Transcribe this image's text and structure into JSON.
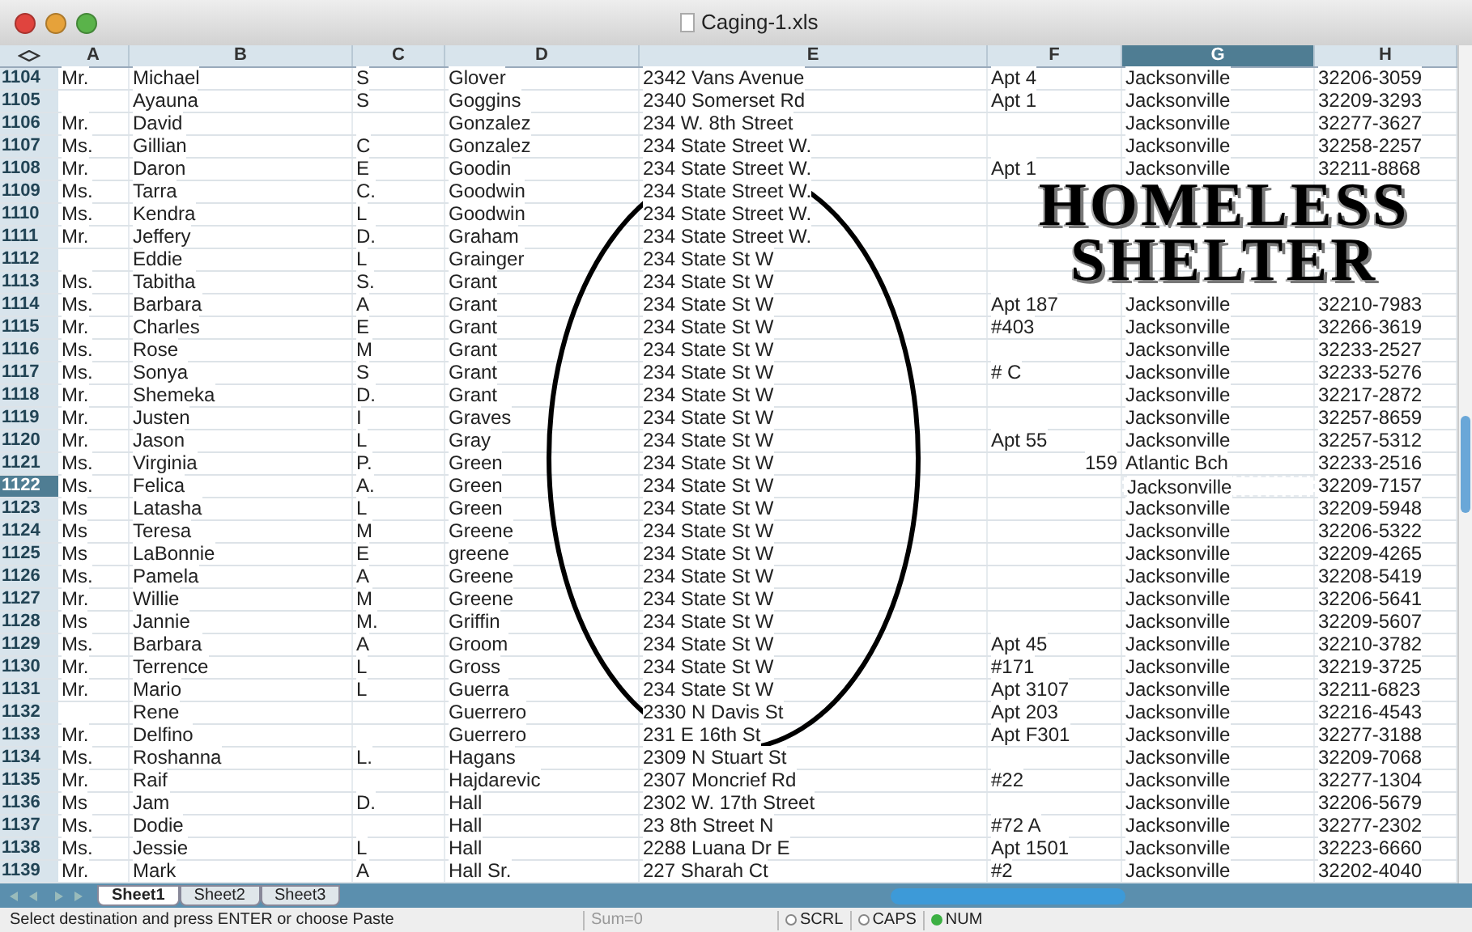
{
  "window": {
    "title": "Caging-1.xls"
  },
  "columns": [
    {
      "label": "A",
      "selected": false
    },
    {
      "label": "B",
      "selected": false
    },
    {
      "label": "C",
      "selected": false
    },
    {
      "label": "D",
      "selected": false
    },
    {
      "label": "E",
      "selected": false
    },
    {
      "label": "F",
      "selected": false
    },
    {
      "label": "G",
      "selected": true
    },
    {
      "label": "H",
      "selected": false
    }
  ],
  "rows": [
    {
      "number": "1104",
      "selected": false,
      "cells": [
        "Mr.",
        "Michael",
        "S",
        "Glover",
        "2342 Vans Avenue",
        "Apt 4",
        "Jacksonville",
        "32206-3059"
      ]
    },
    {
      "number": "1105",
      "selected": false,
      "cells": [
        null,
        "Ayauna",
        "S",
        "Goggins",
        "2340 Somerset Rd",
        "Apt 1",
        "Jacksonville",
        "32209-3293"
      ]
    },
    {
      "number": "1106",
      "selected": false,
      "cells": [
        "Mr.",
        "David",
        null,
        "Gonzalez",
        "234 W. 8th Street",
        null,
        "Jacksonville",
        "32277-3627"
      ]
    },
    {
      "number": "1107",
      "selected": false,
      "cells": [
        "Ms.",
        "Gillian",
        "C",
        "Gonzalez",
        "234 State Street W.",
        null,
        "Jacksonville",
        "32258-2257"
      ]
    },
    {
      "number": "1108",
      "selected": false,
      "cells": [
        "Mr.",
        "Daron",
        "E",
        "Goodin",
        "234 State Street W.",
        "Apt 1",
        "Jacksonville",
        "32211-8868"
      ]
    },
    {
      "number": "1109",
      "selected": false,
      "cells": [
        "Ms.",
        "Tarra",
        "C.",
        "Goodwin",
        "234 State Street W.",
        null,
        null,
        null
      ]
    },
    {
      "number": "1110",
      "selected": false,
      "cells": [
        "Ms.",
        "Kendra",
        "L",
        "Goodwin",
        "234 State Street W.",
        null,
        null,
        null
      ]
    },
    {
      "number": "1111",
      "selected": false,
      "cells": [
        "Mr.",
        "Jeffery",
        "D.",
        "Graham",
        "234 State Street W.",
        null,
        null,
        null
      ]
    },
    {
      "number": "1112",
      "selected": false,
      "cells": [
        null,
        "Eddie",
        "L",
        "Grainger",
        "234 State St W",
        null,
        null,
        null
      ]
    },
    {
      "number": "1113",
      "selected": false,
      "cells": [
        "Ms.",
        "Tabitha",
        "S.",
        "Grant",
        "234 State St W",
        null,
        null,
        null
      ]
    },
    {
      "number": "1114",
      "selected": false,
      "cells": [
        "Ms.",
        "Barbara",
        "A",
        "Grant",
        "234 State St W",
        "Apt 187",
        "Jacksonville",
        "32210-7983"
      ]
    },
    {
      "number": "1115",
      "selected": false,
      "cells": [
        "Mr.",
        "Charles",
        "E",
        "Grant",
        "234 State St W",
        "#403",
        "Jacksonville",
        "32266-3619"
      ]
    },
    {
      "number": "1116",
      "selected": false,
      "cells": [
        "Ms.",
        "Rose",
        "M",
        "Grant",
        "234 State St W",
        null,
        "Jacksonville",
        "32233-2527"
      ]
    },
    {
      "number": "1117",
      "selected": false,
      "cells": [
        "Ms.",
        "Sonya",
        "S",
        "Grant",
        "234 State St W",
        "# C",
        "Jacksonville",
        "32233-5276"
      ]
    },
    {
      "number": "1118",
      "selected": false,
      "cells": [
        "Mr.",
        "Shemeka",
        "D.",
        "Grant",
        "234 State St W",
        null,
        "Jacksonville",
        "32217-2872"
      ]
    },
    {
      "number": "1119",
      "selected": false,
      "cells": [
        "Mr.",
        "Justen",
        "I",
        "Graves",
        "234 State St W",
        null,
        "Jacksonville",
        "32257-8659"
      ]
    },
    {
      "number": "1120",
      "selected": false,
      "cells": [
        "Mr.",
        "Jason",
        "L",
        "Gray",
        "234 State St W",
        "Apt 55",
        "Jacksonville",
        "32257-5312"
      ]
    },
    {
      "number": "1121",
      "selected": false,
      "numeric_f": true,
      "cells": [
        "Ms.",
        "Virginia",
        "P.",
        "Green",
        "234 State St W",
        "159",
        "Atlantic Bch",
        "32233-2516"
      ]
    },
    {
      "number": "1122",
      "selected": true,
      "marquee": true,
      "cells": [
        "Ms.",
        "Felica",
        "A.",
        "Green",
        "234 State St W",
        null,
        "Jacksonville",
        "32209-7157"
      ]
    },
    {
      "number": "1123",
      "selected": false,
      "cells": [
        "Ms",
        "Latasha",
        "L",
        "Green",
        "234 State St W",
        null,
        "Jacksonville",
        "32209-5948"
      ]
    },
    {
      "number": "1124",
      "selected": false,
      "cells": [
        "Ms",
        "Teresa",
        "M",
        "Greene",
        "234 State St W",
        null,
        "Jacksonville",
        "32206-5322"
      ]
    },
    {
      "number": "1125",
      "selected": false,
      "cells": [
        "Ms",
        "LaBonnie",
        "E",
        "greene",
        "234 State St W",
        null,
        "Jacksonville",
        "32209-4265"
      ]
    },
    {
      "number": "1126",
      "selected": false,
      "cells": [
        "Ms.",
        "Pamela",
        "A",
        "Greene",
        "234 State St W",
        null,
        "Jacksonville",
        "32208-5419"
      ]
    },
    {
      "number": "1127",
      "selected": false,
      "cells": [
        "Mr.",
        "Willie",
        "M",
        "Greene",
        "234 State St W",
        null,
        "Jacksonville",
        "32206-5641"
      ]
    },
    {
      "number": "1128",
      "selected": false,
      "cells": [
        "Ms",
        "Jannie",
        "M.",
        "Griffin",
        "234 State St W",
        null,
        "Jacksonville",
        "32209-5607"
      ]
    },
    {
      "number": "1129",
      "selected": false,
      "cells": [
        "Ms.",
        "Barbara",
        "A",
        "Groom",
        "234 State St W",
        "Apt 45",
        "Jacksonville",
        "32210-3782"
      ]
    },
    {
      "number": "1130",
      "selected": false,
      "cells": [
        "Mr.",
        "Terrence",
        "L",
        "Gross",
        "234 State St W",
        "#171",
        "Jacksonville",
        "32219-3725"
      ]
    },
    {
      "number": "1131",
      "selected": false,
      "cells": [
        "Mr.",
        "Mario",
        "L",
        "Guerra",
        "234 State St W",
        "Apt 3107",
        "Jacksonville",
        "32211-6823"
      ]
    },
    {
      "number": "1132",
      "selected": false,
      "cells": [
        null,
        "Rene",
        null,
        "Guerrero",
        "2330 N Davis St",
        "Apt 203",
        "Jacksonville",
        "32216-4543"
      ]
    },
    {
      "number": "1133",
      "selected": false,
      "cells": [
        "Mr.",
        "Delfino",
        null,
        "Guerrero",
        "231 E 16th St",
        "Apt F301",
        "Jacksonville",
        "32277-3188"
      ]
    },
    {
      "number": "1134",
      "selected": false,
      "cells": [
        "Ms.",
        "Roshanna",
        "L.",
        "Hagans",
        "2309 N Stuart St",
        null,
        "Jacksonville",
        "32209-7068"
      ]
    },
    {
      "number": "1135",
      "selected": false,
      "cells": [
        "Mr.",
        "Raif",
        null,
        "Hajdarevic",
        "2307 Moncrief Rd",
        "#22",
        "Jacksonville",
        "32277-1304"
      ]
    },
    {
      "number": "1136",
      "selected": false,
      "cells": [
        "Ms",
        "Jam",
        "D.",
        "Hall",
        "2302 W. 17th Street",
        null,
        "Jacksonville",
        "32206-5679"
      ]
    },
    {
      "number": "1137",
      "selected": false,
      "cells": [
        "Ms.",
        "Dodie",
        null,
        "Hall",
        "23 8th Street N",
        "#72 A",
        "Jacksonville",
        "32277-2302"
      ]
    },
    {
      "number": "1138",
      "selected": false,
      "cells": [
        "Ms.",
        "Jessie",
        "L",
        "Hall",
        "2288 Luana Dr E",
        "Apt 1501",
        "Jacksonville",
        "32223-6660"
      ]
    },
    {
      "number": "1139",
      "selected": false,
      "cells": [
        "Mr.",
        "Mark",
        "A",
        "Hall Sr.",
        "227 Sharah Ct",
        "#2",
        "Jacksonville",
        "32202-4040"
      ]
    }
  ],
  "headline": [
    "HOMELESS",
    "SHELTER"
  ],
  "sheet_tabs": [
    {
      "label": "Sheet1",
      "selected": true
    },
    {
      "label": "Sheet2",
      "selected": false
    },
    {
      "label": "Sheet3",
      "selected": false
    }
  ],
  "status_bar": {
    "message": "Select destination and press ENTER or choose Paste",
    "sum": "Sum=0",
    "indicators": [
      {
        "label": "SCRL",
        "on": false
      },
      {
        "label": "CAPS",
        "on": false
      },
      {
        "label": "NUM",
        "on": true
      }
    ]
  }
}
